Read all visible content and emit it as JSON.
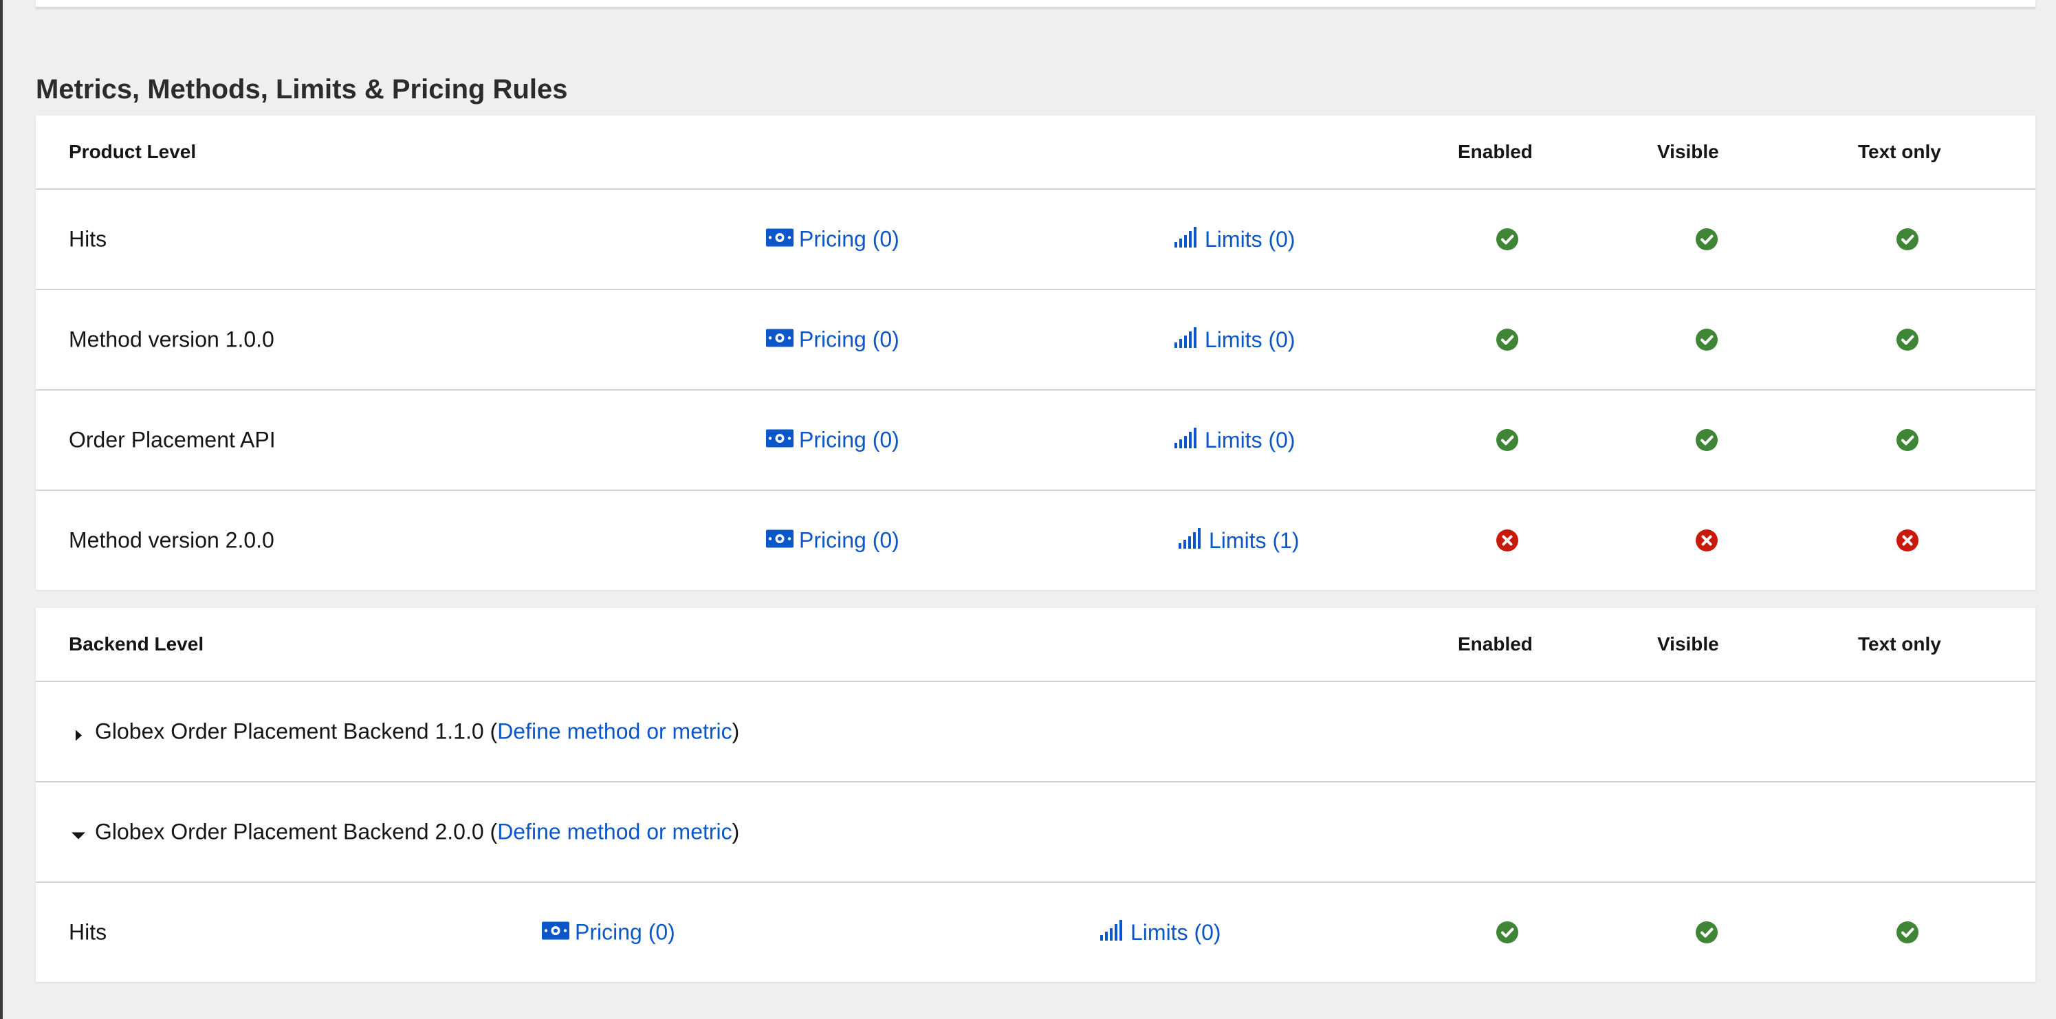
{
  "section": {
    "title": "Metrics, Methods, Limits & Pricing Rules"
  },
  "product": {
    "header": {
      "level": "Product Level",
      "enabled": "Enabled",
      "visible": "Visible",
      "text_only": "Text only"
    },
    "rows": [
      {
        "name": "Hits",
        "pricing": "Pricing (0)",
        "limits": "Limits (0)",
        "enabled": true,
        "visible": true,
        "text_only": true
      },
      {
        "name": "Method version 1.0.0",
        "pricing": "Pricing (0)",
        "limits": "Limits (0)",
        "enabled": true,
        "visible": true,
        "text_only": true
      },
      {
        "name": "Order Placement API",
        "pricing": "Pricing (0)",
        "limits": "Limits (0)",
        "enabled": true,
        "visible": true,
        "text_only": true
      },
      {
        "name": "Method version 2.0.0",
        "pricing": "Pricing (0)",
        "limits": "Limits (1)",
        "enabled": false,
        "visible": false,
        "text_only": false
      }
    ]
  },
  "backend": {
    "header": {
      "level": "Backend Level",
      "enabled": "Enabled",
      "visible": "Visible",
      "text_only": "Text only"
    },
    "groups": [
      {
        "name": "Globex Order Placement Backend 1.1.0",
        "open_paren": "(",
        "define_link": "Define method or metric",
        "close_paren": ")",
        "expanded": false,
        "toggle_icon": "caret-right-icon"
      },
      {
        "name": "Globex Order Placement Backend 2.0.0",
        "open_paren": "(",
        "define_link": "Define method or metric",
        "close_paren": ")",
        "expanded": true,
        "toggle_icon": "caret-down-icon"
      }
    ],
    "rows": [
      {
        "name": "Hits",
        "pricing": "Pricing (0)",
        "limits": "Limits (0)",
        "enabled": true,
        "visible": true,
        "text_only": true
      }
    ]
  },
  "icons": {
    "pricing": "money-bill-icon",
    "limits": "signal-bars-icon",
    "yes": "check-circle-icon",
    "no": "times-circle-icon"
  },
  "colors": {
    "link": "#0b57c9",
    "success": "#3e8635",
    "danger": "#c9190b"
  }
}
